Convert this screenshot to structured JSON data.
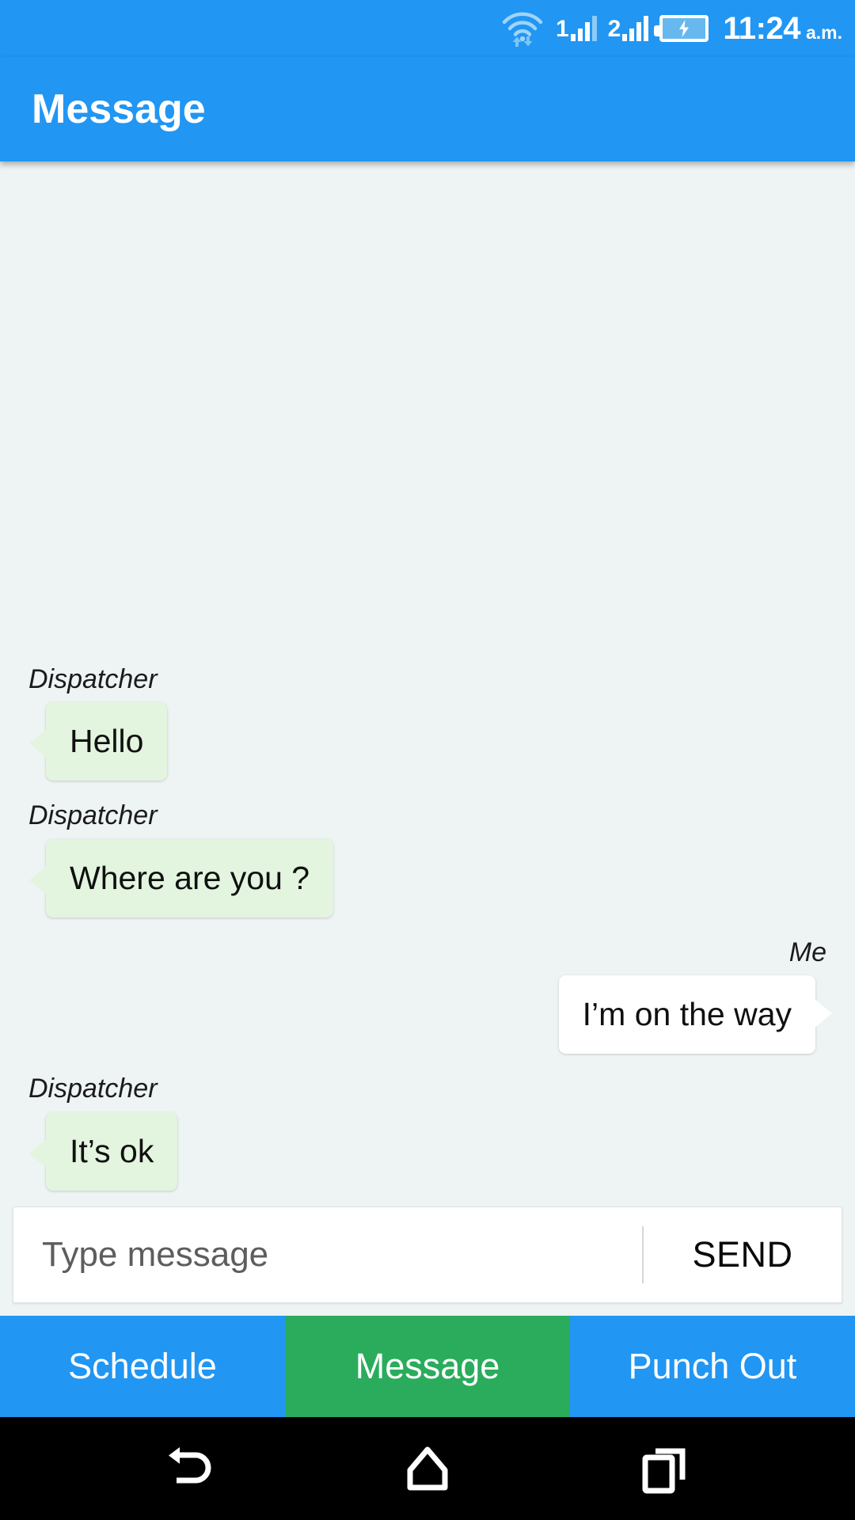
{
  "status_bar": {
    "wifi_icon": "wifi-with-transfer-arrows-icon",
    "sim1": {
      "label": "1",
      "icon": "signal-bars-icon",
      "bars_active": 3,
      "bars_total": 4
    },
    "sim2": {
      "label": "2",
      "icon": "signal-bars-icon",
      "bars_active": 4,
      "bars_total": 4
    },
    "battery": {
      "icon": "battery-charging-icon",
      "charging": true
    },
    "time": "11:24",
    "period": "a.m."
  },
  "app_bar": {
    "title": "Message",
    "background": "#2196f3"
  },
  "conversation": {
    "messages": [
      {
        "sender": "Dispatcher",
        "text": "Hello",
        "side": "left"
      },
      {
        "sender": "Dispatcher",
        "text": "Where are you ?",
        "side": "left"
      },
      {
        "sender": "Me",
        "text": "I’m on the way",
        "side": "right"
      },
      {
        "sender": "Dispatcher",
        "text": "It’s ok",
        "side": "left"
      }
    ],
    "bubble_color_them": "#e3f4df",
    "bubble_color_me": "#ffffff",
    "background": "#eef3f3"
  },
  "composer": {
    "placeholder": "Type message",
    "value": "",
    "send_label": "SEND"
  },
  "tab_bar": {
    "tabs": [
      {
        "label": "Schedule",
        "active": false,
        "color": "#2196f3"
      },
      {
        "label": "Message",
        "active": true,
        "color": "#2aac5c"
      },
      {
        "label": "Punch Out",
        "active": false,
        "color": "#2196f3"
      }
    ]
  },
  "nav_bar": {
    "back_icon": "back-arrow-icon",
    "home_icon": "home-icon",
    "recents_icon": "recent-apps-icon"
  }
}
